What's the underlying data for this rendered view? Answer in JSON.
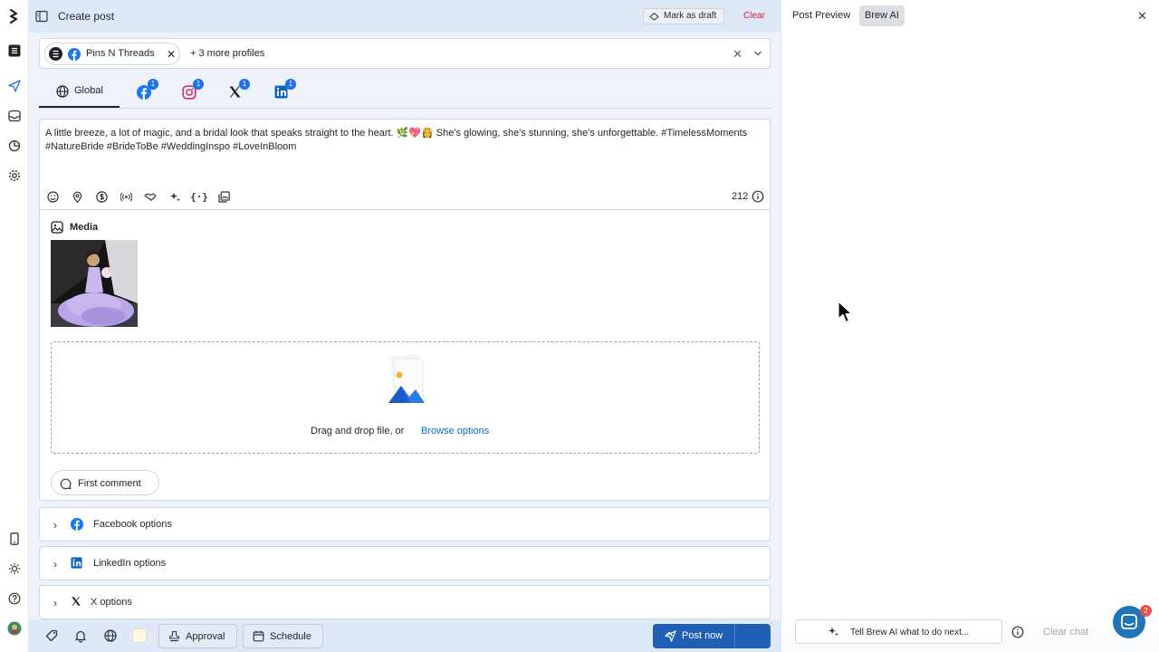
{
  "header": {
    "title": "Create post",
    "mark_draft": "Mark as draft",
    "clear": "Clear"
  },
  "profiles": {
    "chip_label": "Pins N Threads",
    "more": "+ 3 more profiles"
  },
  "tabs": {
    "global": "Global",
    "networks": [
      {
        "name": "facebook",
        "badge": "1"
      },
      {
        "name": "instagram",
        "badge": "1"
      },
      {
        "name": "x",
        "badge": "1"
      },
      {
        "name": "linkedin",
        "badge": "1"
      }
    ]
  },
  "compose": {
    "text_line1": "A little breeze, a lot of magic, and a bridal look that speaks straight to the heart. 🌿💖👸 She's glowing, she's stunning, she's unforgettable. #TimelessMoments",
    "text_line2": "#NatureBride #BrideToBe #WeddingInspo #LoveInBloom",
    "char_count": "212",
    "media_label": "Media",
    "drop_text": "Drag and drop file, or",
    "browse": "Browse options",
    "first_comment": "First comment"
  },
  "options": {
    "facebook": "Facebook options",
    "linkedin": "LinkedIn options",
    "x": "X options"
  },
  "bottom": {
    "approval": "Approval",
    "schedule": "Schedule",
    "post_now": "Post now"
  },
  "right_panel": {
    "tab_preview": "Post Preview",
    "tab_ai": "Brew AI",
    "ask_placeholder": "Tell Brew AI what to do next...",
    "clear_chat": "Clear chat",
    "chat_badge": "2"
  },
  "colors": {
    "accent": "#1f5fb4",
    "header_bg": "#dfe8f8",
    "link": "#0969da",
    "danger": "#cf222e"
  }
}
